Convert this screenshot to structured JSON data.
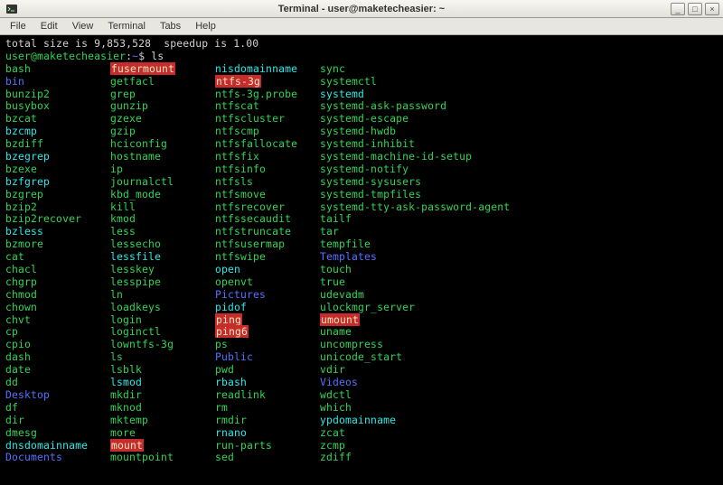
{
  "window": {
    "title": "Terminal - user@maketecheasier: ~"
  },
  "menu": {
    "items": [
      "File",
      "Edit",
      "View",
      "Terminal",
      "Tabs",
      "Help"
    ]
  },
  "titlebar_controls": {
    "min": "_",
    "max": "□",
    "close": "×"
  },
  "terminal": {
    "status_line": "total size is 9,853,528  speedup is 1.00",
    "prompt_user": "user@maketecheasier",
    "prompt_sep": ":",
    "prompt_path": "~",
    "prompt_tail": "$ ",
    "command": "ls",
    "columns": [
      [
        {
          "t": "bash",
          "c": "green"
        },
        {
          "t": "bin",
          "c": "blue"
        },
        {
          "t": "bunzip2",
          "c": "green"
        },
        {
          "t": "busybox",
          "c": "green"
        },
        {
          "t": "bzcat",
          "c": "green"
        },
        {
          "t": "bzcmp",
          "c": "cyan"
        },
        {
          "t": "bzdiff",
          "c": "green"
        },
        {
          "t": "bzegrep",
          "c": "cyan"
        },
        {
          "t": "bzexe",
          "c": "green"
        },
        {
          "t": "bzfgrep",
          "c": "cyan"
        },
        {
          "t": "bzgrep",
          "c": "green"
        },
        {
          "t": "bzip2",
          "c": "green"
        },
        {
          "t": "bzip2recover",
          "c": "green"
        },
        {
          "t": "bzless",
          "c": "cyan"
        },
        {
          "t": "bzmore",
          "c": "green"
        },
        {
          "t": "cat",
          "c": "green"
        },
        {
          "t": "chacl",
          "c": "green"
        },
        {
          "t": "chgrp",
          "c": "green"
        },
        {
          "t": "chmod",
          "c": "green"
        },
        {
          "t": "chown",
          "c": "green"
        },
        {
          "t": "chvt",
          "c": "green"
        },
        {
          "t": "cp",
          "c": "green"
        },
        {
          "t": "cpio",
          "c": "green"
        },
        {
          "t": "dash",
          "c": "green"
        },
        {
          "t": "date",
          "c": "green"
        },
        {
          "t": "dd",
          "c": "green"
        },
        {
          "t": "Desktop",
          "c": "blue"
        },
        {
          "t": "df",
          "c": "green"
        },
        {
          "t": "dir",
          "c": "green"
        },
        {
          "t": "dmesg",
          "c": "green"
        },
        {
          "t": "dnsdomainname",
          "c": "cyan"
        },
        {
          "t": "Documents",
          "c": "blue"
        }
      ],
      [
        {
          "t": "fusermount",
          "c": "redbg"
        },
        {
          "t": "getfacl",
          "c": "green"
        },
        {
          "t": "grep",
          "c": "green"
        },
        {
          "t": "gunzip",
          "c": "green"
        },
        {
          "t": "gzexe",
          "c": "green"
        },
        {
          "t": "gzip",
          "c": "green"
        },
        {
          "t": "hciconfig",
          "c": "green"
        },
        {
          "t": "hostname",
          "c": "green"
        },
        {
          "t": "ip",
          "c": "green"
        },
        {
          "t": "journalctl",
          "c": "green"
        },
        {
          "t": "kbd_mode",
          "c": "green"
        },
        {
          "t": "kill",
          "c": "green"
        },
        {
          "t": "kmod",
          "c": "green"
        },
        {
          "t": "less",
          "c": "green"
        },
        {
          "t": "lessecho",
          "c": "green"
        },
        {
          "t": "lessfile",
          "c": "cyan"
        },
        {
          "t": "lesskey",
          "c": "green"
        },
        {
          "t": "lesspipe",
          "c": "green"
        },
        {
          "t": "ln",
          "c": "green"
        },
        {
          "t": "loadkeys",
          "c": "green"
        },
        {
          "t": "login",
          "c": "green"
        },
        {
          "t": "loginctl",
          "c": "green"
        },
        {
          "t": "lowntfs-3g",
          "c": "green"
        },
        {
          "t": "ls",
          "c": "green"
        },
        {
          "t": "lsblk",
          "c": "green"
        },
        {
          "t": "lsmod",
          "c": "cyan"
        },
        {
          "t": "mkdir",
          "c": "green"
        },
        {
          "t": "mknod",
          "c": "green"
        },
        {
          "t": "mktemp",
          "c": "green"
        },
        {
          "t": "more",
          "c": "green"
        },
        {
          "t": "mount",
          "c": "redbg"
        },
        {
          "t": "mountpoint",
          "c": "green"
        }
      ],
      [
        {
          "t": "nisdomainname",
          "c": "cyan"
        },
        {
          "t": "ntfs-3g",
          "c": "redbg"
        },
        {
          "t": "ntfs-3g.probe",
          "c": "green"
        },
        {
          "t": "ntfscat",
          "c": "green"
        },
        {
          "t": "ntfscluster",
          "c": "green"
        },
        {
          "t": "ntfscmp",
          "c": "green"
        },
        {
          "t": "ntfsfallocate",
          "c": "green"
        },
        {
          "t": "ntfsfix",
          "c": "green"
        },
        {
          "t": "ntfsinfo",
          "c": "green"
        },
        {
          "t": "ntfsls",
          "c": "green"
        },
        {
          "t": "ntfsmove",
          "c": "green"
        },
        {
          "t": "ntfsrecover",
          "c": "green"
        },
        {
          "t": "ntfssecaudit",
          "c": "green"
        },
        {
          "t": "ntfstruncate",
          "c": "green"
        },
        {
          "t": "ntfsusermap",
          "c": "green"
        },
        {
          "t": "ntfswipe",
          "c": "green"
        },
        {
          "t": "open",
          "c": "cyan"
        },
        {
          "t": "openvt",
          "c": "green"
        },
        {
          "t": "Pictures",
          "c": "blue"
        },
        {
          "t": "pidof",
          "c": "cyan"
        },
        {
          "t": "ping",
          "c": "redbg"
        },
        {
          "t": "ping6",
          "c": "redbg"
        },
        {
          "t": "ps",
          "c": "green"
        },
        {
          "t": "Public",
          "c": "blue"
        },
        {
          "t": "pwd",
          "c": "green"
        },
        {
          "t": "rbash",
          "c": "cyan"
        },
        {
          "t": "readlink",
          "c": "green"
        },
        {
          "t": "rm",
          "c": "green"
        },
        {
          "t": "rmdir",
          "c": "green"
        },
        {
          "t": "rnano",
          "c": "cyan"
        },
        {
          "t": "run-parts",
          "c": "green"
        },
        {
          "t": "sed",
          "c": "green"
        }
      ],
      [
        {
          "t": "sync",
          "c": "green"
        },
        {
          "t": "systemctl",
          "c": "green"
        },
        {
          "t": "systemd",
          "c": "cyan"
        },
        {
          "t": "systemd-ask-password",
          "c": "green"
        },
        {
          "t": "systemd-escape",
          "c": "green"
        },
        {
          "t": "systemd-hwdb",
          "c": "green"
        },
        {
          "t": "systemd-inhibit",
          "c": "green"
        },
        {
          "t": "systemd-machine-id-setup",
          "c": "green"
        },
        {
          "t": "systemd-notify",
          "c": "green"
        },
        {
          "t": "systemd-sysusers",
          "c": "green"
        },
        {
          "t": "systemd-tmpfiles",
          "c": "green"
        },
        {
          "t": "systemd-tty-ask-password-agent",
          "c": "green"
        },
        {
          "t": "tailf",
          "c": "green"
        },
        {
          "t": "tar",
          "c": "green"
        },
        {
          "t": "tempfile",
          "c": "green"
        },
        {
          "t": "Templates",
          "c": "blue"
        },
        {
          "t": "touch",
          "c": "green"
        },
        {
          "t": "true",
          "c": "green"
        },
        {
          "t": "udevadm",
          "c": "green"
        },
        {
          "t": "ulockmgr_server",
          "c": "green"
        },
        {
          "t": "umount",
          "c": "redbg"
        },
        {
          "t": "uname",
          "c": "green"
        },
        {
          "t": "uncompress",
          "c": "green"
        },
        {
          "t": "unicode_start",
          "c": "green"
        },
        {
          "t": "vdir",
          "c": "green"
        },
        {
          "t": "Videos",
          "c": "blue"
        },
        {
          "t": "wdctl",
          "c": "green"
        },
        {
          "t": "which",
          "c": "green"
        },
        {
          "t": "ypdomainname",
          "c": "cyan"
        },
        {
          "t": "zcat",
          "c": "green"
        },
        {
          "t": "zcmp",
          "c": "green"
        },
        {
          "t": "zdiff",
          "c": "green"
        }
      ]
    ]
  }
}
